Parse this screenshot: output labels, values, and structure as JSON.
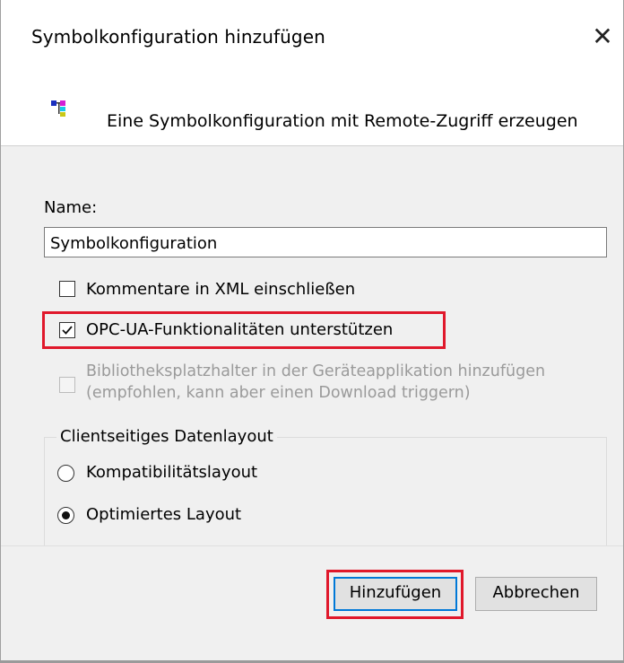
{
  "dialog": {
    "title": "Symbolkonfiguration hinzufügen",
    "close_glyph": "✕",
    "header_text": "Eine Symbolkonfiguration mit Remote-Zugriff erzeugen",
    "header_icon": "symbol-configuration-icon"
  },
  "form": {
    "name_label": "Name:",
    "name_value": "Symbolkonfiguration",
    "checkboxes": [
      {
        "label": "Kommentare in XML einschließen",
        "checked": false,
        "enabled": true
      },
      {
        "label": "OPC-UA-Funktionalitäten unterstützen",
        "checked": true,
        "enabled": true,
        "highlighted": true
      },
      {
        "label_line1": "Bibliotheksplatzhalter in der Geräteapplikation hinzufügen",
        "label_line2": "(empfohlen, kann aber einen Download triggern)",
        "checked": false,
        "enabled": false
      }
    ],
    "layout_group": {
      "title": "Clientseitiges Datenlayout",
      "options": [
        {
          "label": "Kompatibilitätslayout",
          "selected": false
        },
        {
          "label": "Optimiertes Layout",
          "selected": true
        }
      ]
    }
  },
  "buttons": {
    "add": "Hinzufügen",
    "cancel": "Abbrechen"
  },
  "colors": {
    "highlight": "#e0182b",
    "focus": "#0078d7",
    "body_bg": "#f0f0f0"
  }
}
